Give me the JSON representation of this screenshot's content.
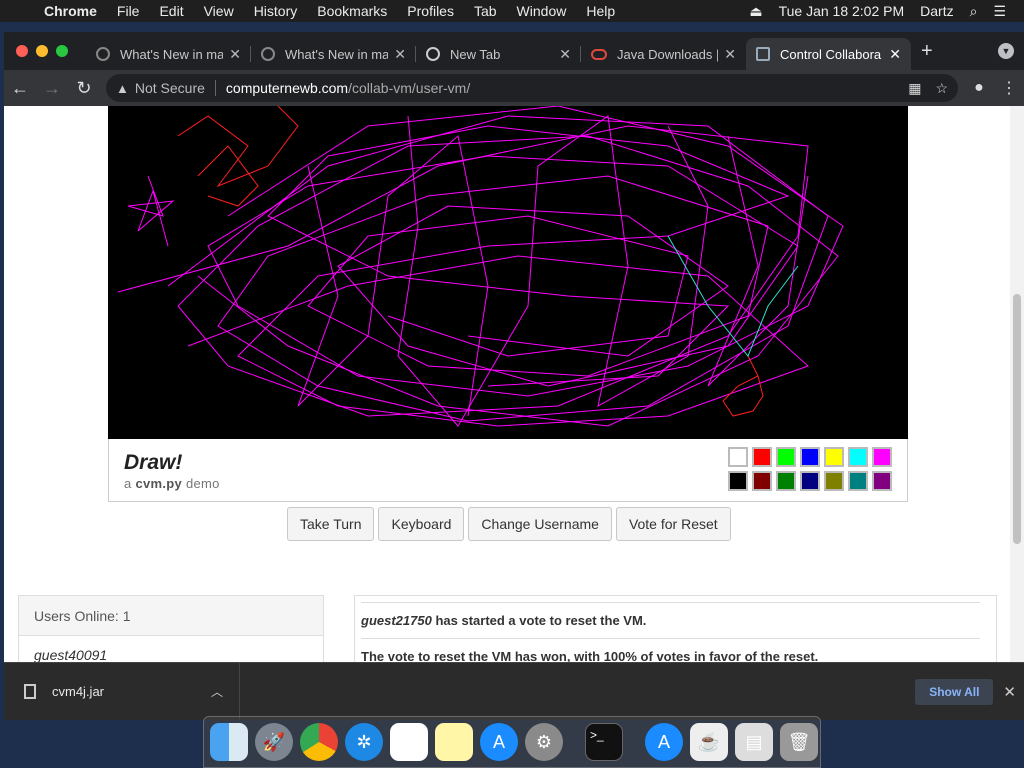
{
  "menubar": {
    "app_name": "Chrome",
    "items": [
      "File",
      "Edit",
      "View",
      "History",
      "Bookmarks",
      "Profiles",
      "Tab",
      "Window",
      "Help"
    ],
    "datetime": "Tue Jan 18  2:02 PM",
    "user": "Dartz"
  },
  "tabs": [
    {
      "title": "What's New in ma",
      "icon": "globe-icon"
    },
    {
      "title": "What's New in ma",
      "icon": "globe-icon"
    },
    {
      "title": "New Tab",
      "icon": "chrome-icon"
    },
    {
      "title": "Java Downloads |",
      "icon": "oracle-icon"
    },
    {
      "title": "Control Collabora",
      "icon": "cvm-icon",
      "active": true
    }
  ],
  "omnibox": {
    "security": "Not Secure",
    "host": "computernewb.com",
    "path": "/collab-vm/user-vm/"
  },
  "draw_panel": {
    "title": "Draw!",
    "subtitle_prefix": "a",
    "subtitle_name": "cvm.py",
    "subtitle_suffix": "demo",
    "palette": [
      "#ffffff",
      "#ff0000",
      "#00ff00",
      "#0000ff",
      "#ffff00",
      "#00ffff",
      "#ff00ff",
      "#000000",
      "#800000",
      "#008000",
      "#000080",
      "#808000",
      "#008080",
      "#800080"
    ]
  },
  "buttons": {
    "take_turn": "Take Turn",
    "keyboard": "Keyboard",
    "change_username": "Change Username",
    "vote_reset": "Vote for Reset"
  },
  "users": {
    "header": "Users Online: 1",
    "list": [
      "guest40091"
    ]
  },
  "chat": {
    "messages": [
      {
        "user": "guest21750",
        "text": "has started a vote to reset the VM."
      },
      {
        "user": "",
        "text": "The vote to reset the VM has won, with 100% of votes in favor of the reset."
      }
    ]
  },
  "download": {
    "filename": "cvm4j.jar",
    "show_all": "Show All"
  },
  "dock_apps": [
    "Finder",
    "Launchpad",
    "Chrome",
    "Safari",
    "Calendar",
    "Notes",
    "App Store",
    "System Preferences",
    "Terminal",
    "App Store",
    "Java",
    "Preview",
    "Trash"
  ],
  "colors": {
    "accent_draw_magenta": "#ff00ff",
    "accent_draw_red": "#ff2020",
    "accent_draw_cyan": "#30e0d0"
  }
}
